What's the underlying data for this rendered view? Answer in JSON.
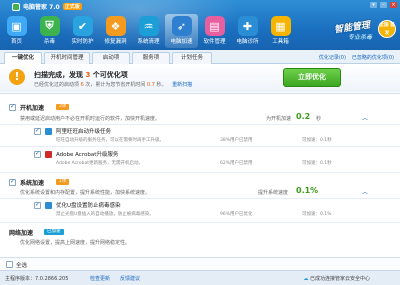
{
  "app": {
    "title": "电脑管家 7.0",
    "edition": "正式版"
  },
  "nav": [
    {
      "label": "首页",
      "icon": "monitor-icon",
      "color": "#3fa9f5"
    },
    {
      "label": "杀毒",
      "icon": "shield-icon",
      "color": "#3db34f"
    },
    {
      "label": "实时防护",
      "icon": "check-shield-icon",
      "color": "#29a3e0"
    },
    {
      "label": "修复漏洞",
      "icon": "windows-logo-icon",
      "color": "#f39a1f"
    },
    {
      "label": "系统清理",
      "icon": "broom-icon",
      "color": "#1c9fd6"
    },
    {
      "label": "电脑加速",
      "icon": "rocket-icon",
      "color": "#2f7fd1"
    },
    {
      "label": "软件管理",
      "icon": "software-box-icon",
      "color": "#e85fa0"
    },
    {
      "label": "电脑诊所",
      "icon": "clinic-icon",
      "color": "#2b8ed5"
    },
    {
      "label": "工具箱",
      "icon": "toolbox-icon",
      "color": "#f4b400"
    }
  ],
  "slogan": {
    "main": "智能管理",
    "sub": "专业杀毒",
    "seal": "全国 首发"
  },
  "tabs": [
    "一键优化",
    "开机时间管理",
    "启动项",
    "服务项",
    "计划任务"
  ],
  "toplinks": {
    "history": "优化记录(0)",
    "ignored": "已忽略的优化项(0)"
  },
  "summary": {
    "head_a": "扫描完成，发现",
    "count": "3",
    "head_b": "个可优化项",
    "line_a": "已经优化过的启动项",
    "optimized": "6",
    "line_b": "次，累计为您节省开机时间",
    "saved": "0.7",
    "line_c": "秒。",
    "rescan": "重新扫描",
    "button": "立即优化"
  },
  "sections": [
    {
      "title": "开机加速",
      "badge": "2项",
      "badge_color": "#f39a1f",
      "desc": "禁用或延迟启动用户不必在开机时运行的软件，加快开机速度。",
      "result_label": "为开机加速",
      "value": "0.2",
      "unit": "秒",
      "items": [
        {
          "title": "阿里旺旺启动升级任务",
          "desc": "旺旺自动升级的服务任务，可以在需要时再手工升级。",
          "stat": "38%用户已禁用",
          "save": "可加速：0.1秒",
          "icon_color": "#2b8ed5"
        },
        {
          "title": "Adobe Acrobat升级服务",
          "desc": "Adobe Acrobat更新服务，无需开机启动。",
          "stat": "62%用户已禁用",
          "save": "可加速：0.1秒",
          "icon_color": "#d02a2a"
        }
      ]
    },
    {
      "title": "系统加速",
      "badge": "1项",
      "badge_color": "#f39a1f",
      "desc": "优化系统设置和内存配置，提升系统性能，加快系统速度。",
      "result_label": "提升系统速度",
      "value": "0.1%",
      "unit": "",
      "items": [
        {
          "title": "优化U盘设置防止病毒感染",
          "desc": "禁止光盘U盘插入的自动播放，防止被病毒感染。",
          "stat": "96%用户已优化",
          "save": "可加速：0.1%",
          "icon_color": "#2b8ed5"
        }
      ]
    },
    {
      "title": "网络加速",
      "badge": "已加速",
      "badge_color": "#1c9fd6",
      "desc": "优化网络设置，提高上网速度，提升网络稳定性。"
    }
  ],
  "footer": {
    "select_all": "全选",
    "version": "主程序版本：7.0.2866.205",
    "check_update": "检查更新",
    "feedback": "反馈建议",
    "cloud": "已成功连接管家云安全中心"
  }
}
